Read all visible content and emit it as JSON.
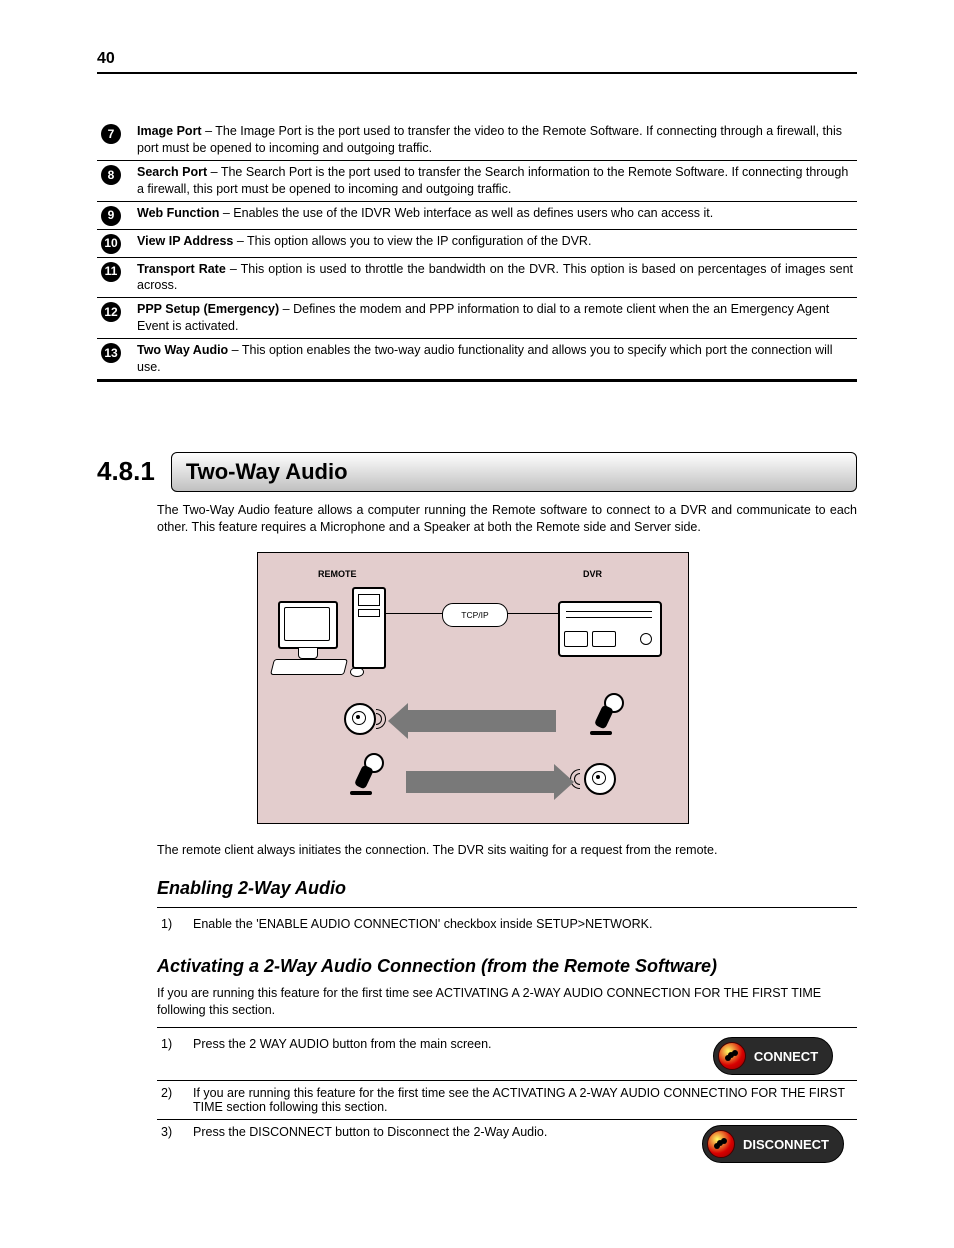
{
  "page_number": "40",
  "glossary": [
    {
      "num": "7",
      "term": "Image Port",
      "desc": " – The Image Port is the port used to transfer the video to the Remote Software. If connecting through a firewall, this port must be opened to incoming and outgoing traffic.",
      "justify": false
    },
    {
      "num": "8",
      "term": "Search Port",
      "desc": " – The Search Port is the port used to transfer the Search information to the Remote Software. If connecting through a firewall, this port must be opened to incoming and outgoing traffic.",
      "justify": false
    },
    {
      "num": "9",
      "term": "Web Function",
      "desc": " – Enables the use of the IDVR Web interface as well as defines users who can access it.",
      "justify": false
    },
    {
      "num": "10",
      "term": "View IP Address",
      "desc": " – This option allows you to view the IP configuration of the DVR.",
      "justify": false
    },
    {
      "num": "11",
      "term": "Transport Rate",
      "desc": " – This option is used to throttle the bandwidth on the DVR. This option is based on percentages of images sent across.",
      "justify": true
    },
    {
      "num": "12",
      "term": "PPP Setup (Emergency)",
      "desc": " – Defines the modem and PPP information to dial to a remote client when the an Emergency Agent Event is activated.",
      "justify": false
    },
    {
      "num": "13",
      "term": "Two Way Audio",
      "desc": " – This option enables the two-way audio functionality and allows you to specify which port the connection will use.",
      "justify": false
    }
  ],
  "section": {
    "num": "4.8.1",
    "title": "Two-Way Audio",
    "intro": "The Two-Way Audio feature allows a computer running the Remote software to connect to a DVR and communicate to each other. This feature requires a Microphone and a Speaker at both the Remote side and Server side.",
    "diagram": {
      "remote_label": "REMOTE",
      "dvr_label": "DVR",
      "tcpip_label": "TCP/IP"
    },
    "note": "The remote client always initiates the connection. The DVR sits waiting for a request from the remote."
  },
  "enabling": {
    "heading": "Enabling 2-Way Audio",
    "steps": [
      {
        "n": "1)",
        "text": "Enable the 'ENABLE AUDIO CONNECTION' checkbox inside SETUP>NETWORK."
      }
    ]
  },
  "activating": {
    "heading": "Activating a 2-Way Audio Connection (from the Remote Software)",
    "intro": "If you are running this feature for the first time see ACTIVATING A 2-WAY AUDIO CONNECTION FOR THE FIRST TIME following this section.",
    "steps": [
      {
        "n": "1)",
        "text": "Press the 2 WAY AUDIO button from the main screen.",
        "button": "CONNECT"
      },
      {
        "n": "2)",
        "text": "If you are running this feature for the first time see the ACTIVATING A 2-WAY AUDIO CONNECTINO FOR THE FIRST TIME section following this section."
      },
      {
        "n": "3)",
        "text": "Press the DISCONNECT button to Disconnect the 2-Way Audio.",
        "button": "DISCONNECT"
      }
    ]
  }
}
